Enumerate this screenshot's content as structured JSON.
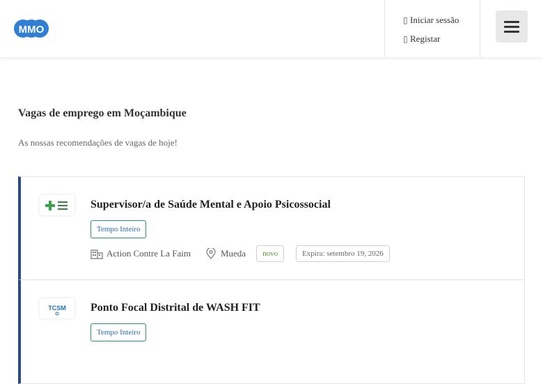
{
  "header": {
    "logo_alt": "MMO",
    "login_label": "Iniciar sessão",
    "register_label": "Registar"
  },
  "main": {
    "title": "Vagas de emprego em Moçambique",
    "subtitle": "As nossas recomendações de vagas de hoje!"
  },
  "jobs": [
    {
      "title": "Supervisor/a de Saúde Mental e Apoio Psicossocial",
      "type": "Tempo Inteiro",
      "company": "Action Contre La Faim",
      "location": "Mueda",
      "new_label": "novo",
      "expiry": "Expira: setembro 19, 2026",
      "logo_icon": "action-contre-la-faim-logo"
    },
    {
      "title": "Ponto Focal Distrital de WASH FIT",
      "type": "Tempo Inteiro",
      "logo_icon": "tcsm-logo"
    }
  ],
  "icons": {
    "login": "user-icon",
    "register": "pencil-icon",
    "menu": "hamburger-menu-icon",
    "company": "building-icon",
    "location": "map-pin-icon"
  },
  "colors": {
    "accent": "#2b4a8b",
    "type_text": "#2d6cb5",
    "new_text": "#4f9a2e",
    "logo_blue": "#2f7fd6"
  }
}
